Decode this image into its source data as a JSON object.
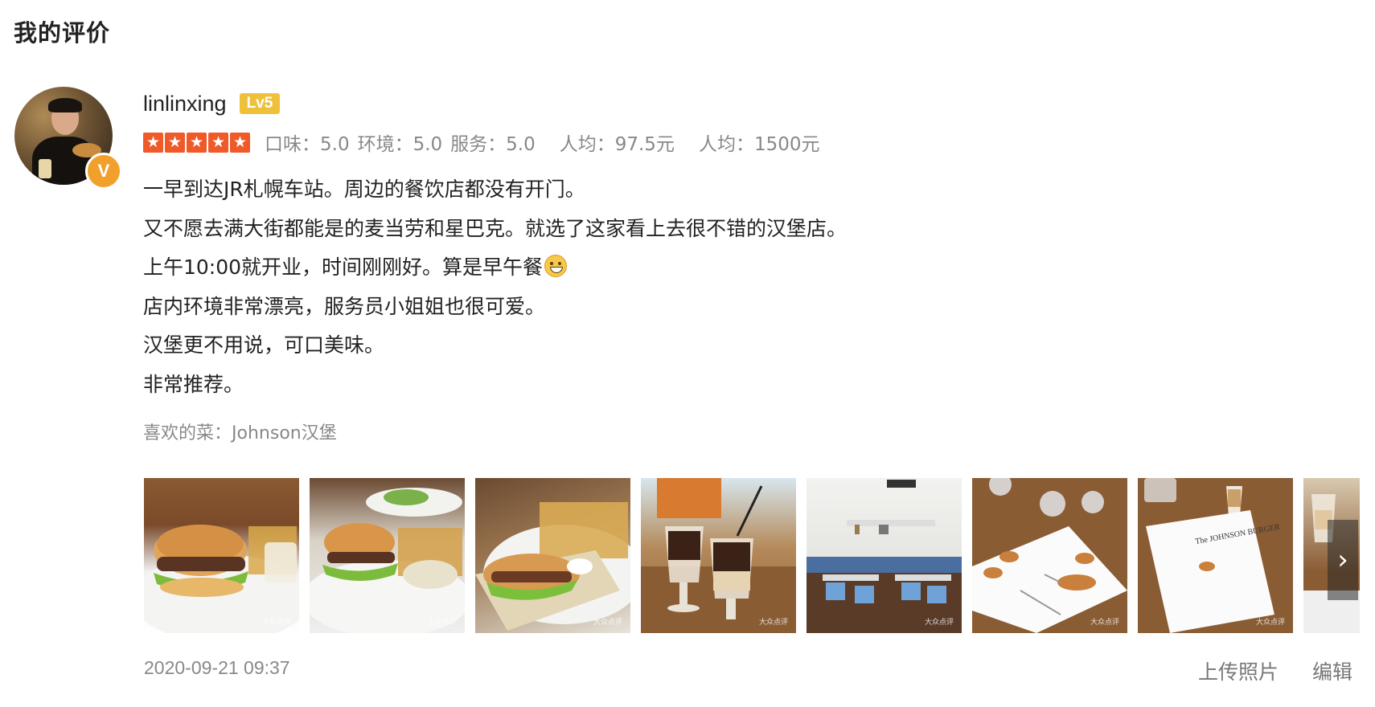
{
  "page_title": "我的评价",
  "user": {
    "name": "linlinxing",
    "level": "Lv5",
    "vip_mark": "V"
  },
  "rating": {
    "stars": 5,
    "taste_label": "口味：",
    "taste_value": "5.0",
    "env_label": "环境：",
    "env_value": "5.0",
    "service_label": "服务：",
    "service_value": "5.0",
    "avg1_label": "人均：",
    "avg1_value": "97.5元",
    "avg2_label": "人均：",
    "avg2_value": "1500元",
    "star_color": "#f05a28"
  },
  "review": {
    "lines": [
      "一早到达JR札幌车站。周边的餐饮店都没有开门。",
      "又不愿去满大街都能是的麦当劳和星巴克。就选了这家看上去很不错的汉堡店。",
      "上午10:00就开业，时间刚刚好。算是早午餐",
      "店内环境非常漂亮，服务员小姐姐也很可爱。",
      "汉堡更不用说，可口美味。",
      "非常推荐。"
    ],
    "emoji": "grinning-face-emoji"
  },
  "favorite_dish": {
    "label": "喜欢的菜：",
    "value": "Johnson汉堡"
  },
  "photos": [
    {
      "subject": "burger-fries-plate"
    },
    {
      "subject": "burger-fries-plate"
    },
    {
      "subject": "burger-fries-closeup"
    },
    {
      "subject": "iced-coffee-drinks"
    },
    {
      "subject": "restaurant-interior"
    },
    {
      "subject": "menu-on-table"
    },
    {
      "subject": "johnson-burger-menu-cover"
    },
    {
      "subject": "drinks-partial"
    }
  ],
  "photo_watermark": "大众点评",
  "menu_cover_text": "The JOHNSON BURGER",
  "footer": {
    "date": "2020-09-21 09:37",
    "upload_label": "上传照片",
    "edit_label": "编辑"
  }
}
